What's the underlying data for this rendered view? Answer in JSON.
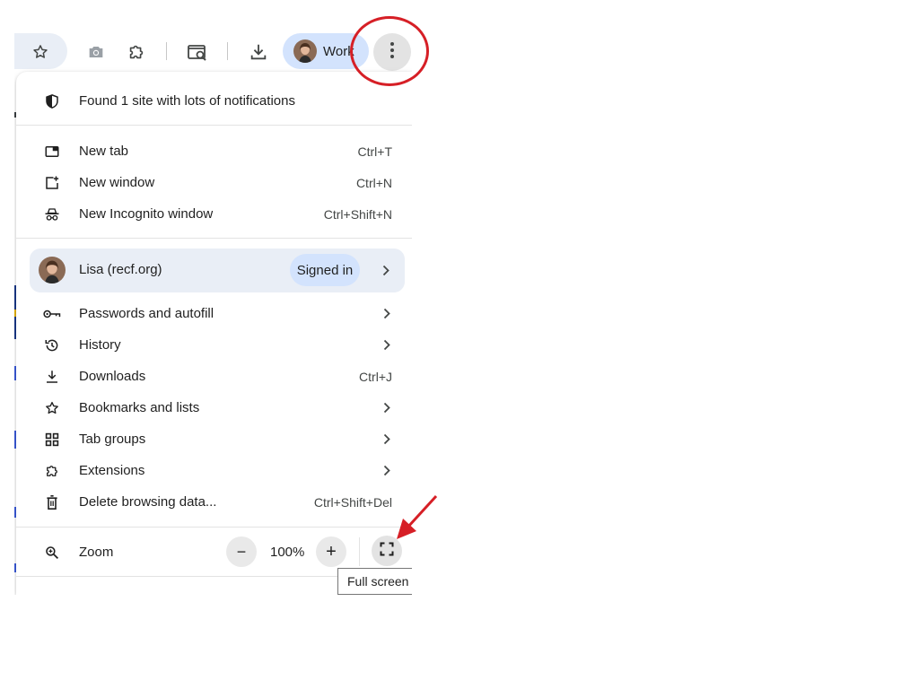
{
  "toolbar": {
    "bookmark_icon": "star-outline-icon",
    "camera_icon": "camera-icon",
    "extension_icon": "puzzle-icon",
    "search_page_icon": "page-search-icon",
    "download_icon": "download-icon",
    "profile_label": "Work",
    "menu_icon": "three-dot-vertical-icon"
  },
  "menu": {
    "notification_text": "Found 1 site with lots of notifications",
    "new_tab": {
      "label": "New tab",
      "shortcut": "Ctrl+T"
    },
    "new_window": {
      "label": "New window",
      "shortcut": "Ctrl+N"
    },
    "new_incognito": {
      "label": "New Incognito window",
      "shortcut": "Ctrl+Shift+N"
    },
    "profile": {
      "name": "Lisa (recf.org)",
      "status": "Signed in"
    },
    "passwords": {
      "label": "Passwords and autofill"
    },
    "history": {
      "label": "History"
    },
    "downloads": {
      "label": "Downloads",
      "shortcut": "Ctrl+J"
    },
    "bookmarks": {
      "label": "Bookmarks and lists"
    },
    "tab_groups": {
      "label": "Tab groups"
    },
    "extensions": {
      "label": "Extensions"
    },
    "delete_data": {
      "label": "Delete browsing data...",
      "shortcut": "Ctrl+Shift+Del"
    },
    "zoom": {
      "label": "Zoom",
      "value": "100%",
      "minus": "−",
      "plus": "+"
    }
  },
  "tooltip": {
    "text": "Full screen"
  },
  "colors": {
    "annotation_red": "#d61f26",
    "profile_pill": "#d3e3fd",
    "profile_row": "#e9eef6"
  }
}
